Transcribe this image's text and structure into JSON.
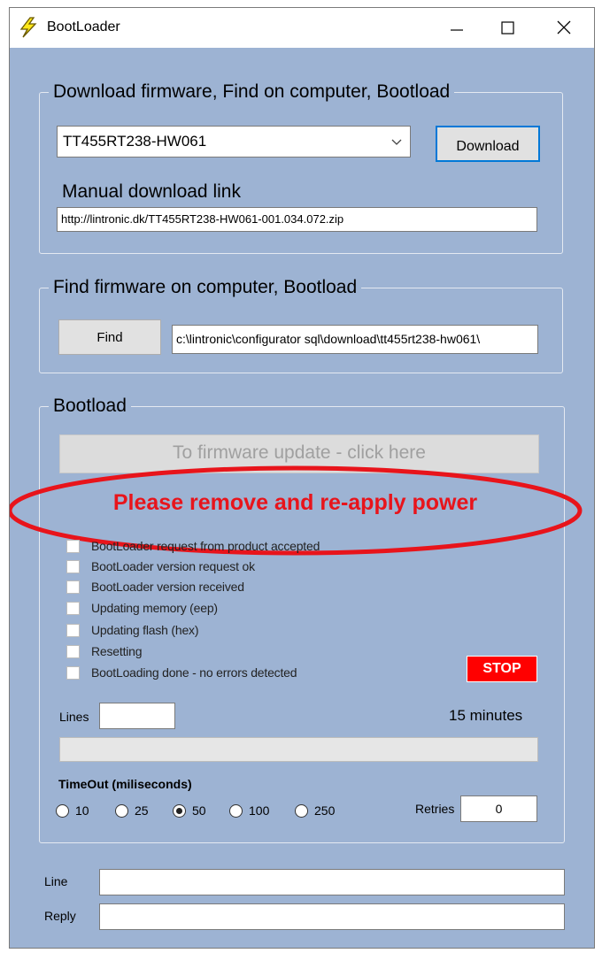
{
  "window": {
    "title": "BootLoader"
  },
  "download_group": {
    "legend": "Download firmware, Find on computer, Bootload",
    "selected_firmware": "TT455RT238-HW061",
    "download_label": "Download",
    "manual_link_label": "Manual download link",
    "manual_link_value": "http://lintronic.dk/TT455RT238-HW061-001.034.072.zip"
  },
  "find_group": {
    "legend": "Find firmware on computer, Bootload",
    "find_label": "Find",
    "path_value": "c:\\lintronic\\configurator sql\\download\\tt455rt238-hw061\\"
  },
  "bootload_group": {
    "legend": "Bootload",
    "update_button_label": "To firmware update - click here",
    "annotation": "Please remove and re-apply power",
    "steps": [
      "BootLoader request from product accepted",
      "BootLoader version request ok",
      "BootLoader version received",
      "Updating memory (eep)",
      "Updating flash (hex)",
      "Resetting",
      "BootLoading done - no errors detected"
    ],
    "stop_label": "STOP",
    "lines_label": "Lines",
    "lines_value": "",
    "duration_text": "15 minutes",
    "progress": 0,
    "timeout_label": "TimeOut (miliseconds)",
    "timeout_options": [
      "10",
      "25",
      "50",
      "100",
      "250"
    ],
    "timeout_selected": "50",
    "retries_label": "Retries",
    "retries_value": "0"
  },
  "footer": {
    "line_label": "Line",
    "line_value": "",
    "reply_label": "Reply",
    "reply_value": ""
  },
  "colors": {
    "window_bg": "#9db3d3",
    "annotation_red": "#e8141b",
    "stop_bg": "#ff0000",
    "default_button_border": "#0078d7"
  }
}
